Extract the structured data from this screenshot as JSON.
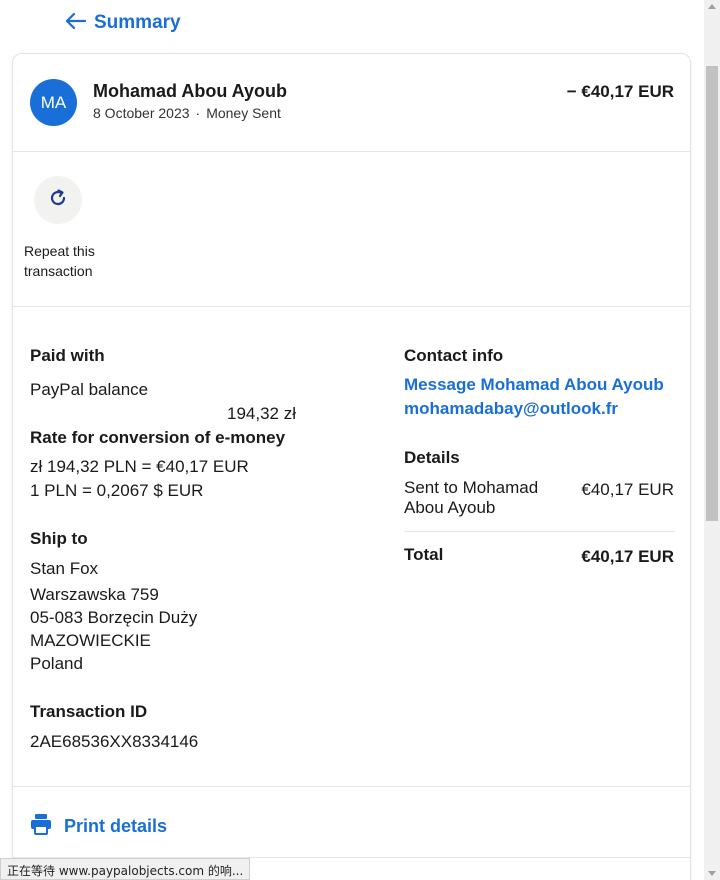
{
  "nav": {
    "back_label": "Summary"
  },
  "transaction": {
    "avatar_initials": "MA",
    "name": "Mohamad Abou Ayoub",
    "date": "8 October 2023",
    "separator": "·",
    "type": "Money Sent",
    "amount": "− €40,17 EUR"
  },
  "actions": {
    "repeat_label": "Repeat this transaction"
  },
  "paid_with": {
    "title": "Paid with",
    "method": "PayPal balance",
    "amount": "194,32 zł"
  },
  "conversion": {
    "title": "Rate for conversion of e-money",
    "line1": "zł 194,32 PLN = €40,17 EUR",
    "line2": "1 PLN = 0,2067 $ EUR"
  },
  "ship_to": {
    "title": "Ship to",
    "name": "Stan Fox",
    "street": "Warszawska 759",
    "city": "05-083 Borzęcin Duży",
    "region": "MAZOWIECKIE",
    "country": "Poland"
  },
  "transaction_id": {
    "title": "Transaction ID",
    "value": "2AE68536XX8334146"
  },
  "contact": {
    "title": "Contact info",
    "message_link": "Message Mohamad Abou Ayoub",
    "email_link": "mohamadabay@outlook.fr"
  },
  "details": {
    "title": "Details",
    "sent_label_line1": "Sent to Mohamad",
    "sent_label_line2": "Abou Ayoub",
    "sent_amount": "€40,17 EUR",
    "total_label": "Total",
    "total_amount": "€40,17 EUR"
  },
  "footer": {
    "print_label": "Print details"
  },
  "status_bar": {
    "text": "正在等待 www.paypalobjects.com 的响..."
  },
  "colors": {
    "accent": "#1a6ed8",
    "avatar_bg": "#1a6ed8",
    "button_bg": "#f2f2f0"
  },
  "icons": [
    "arrow-left-icon",
    "refresh-icon",
    "printer-icon"
  ]
}
